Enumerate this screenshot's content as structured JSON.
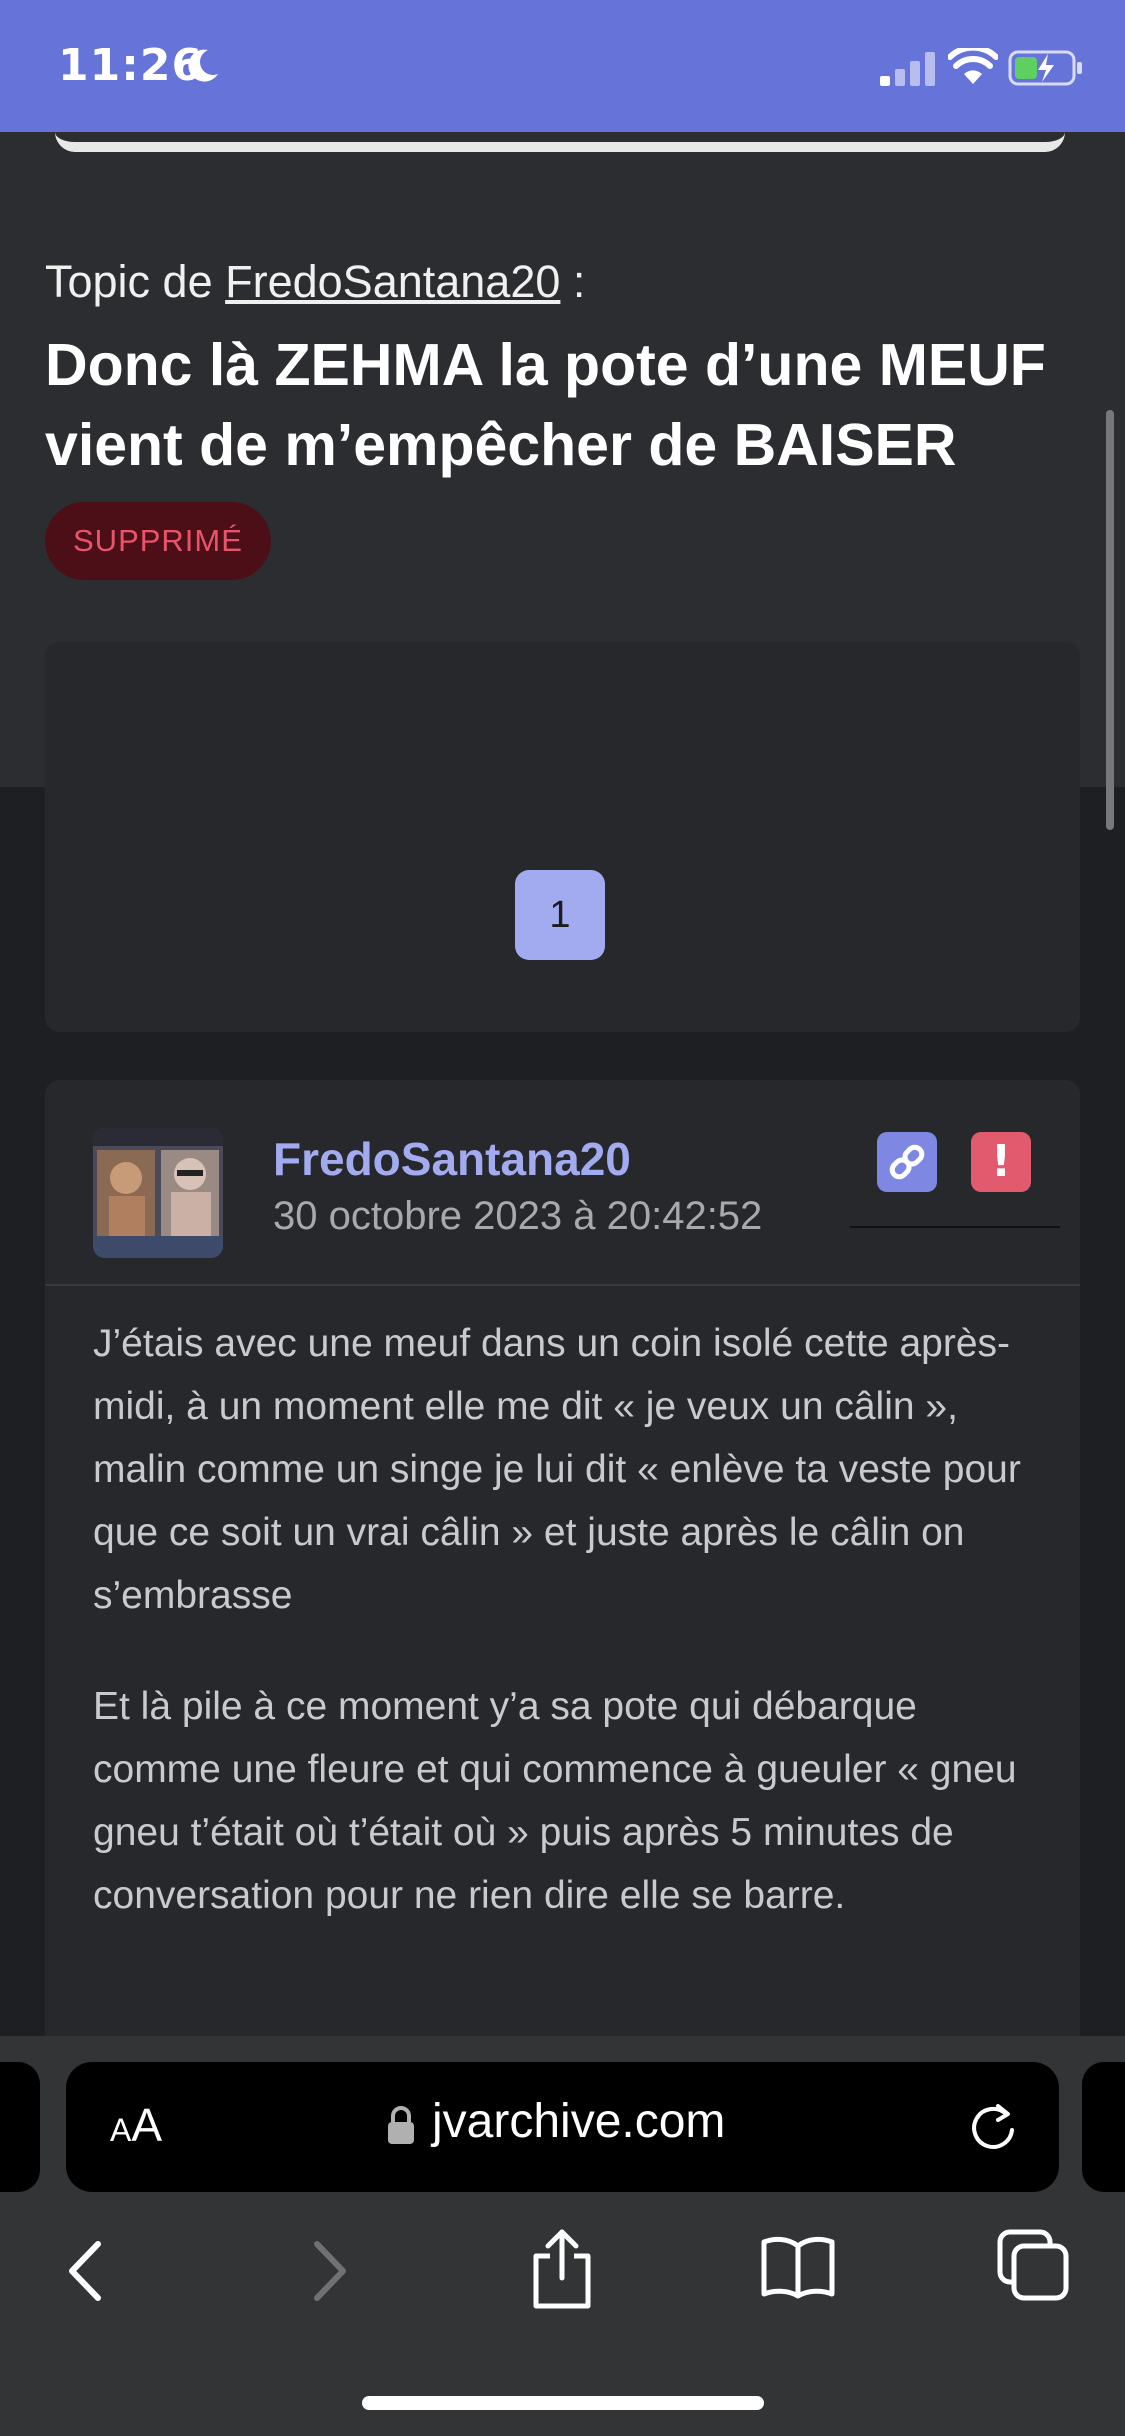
{
  "status_bar": {
    "time": "11:26",
    "icons": [
      "moon-icon",
      "signal-icon",
      "wifi-icon",
      "battery-charging-icon"
    ]
  },
  "topic": {
    "prefix": "Topic de",
    "author": "FredoSantana20",
    "suffix": " :",
    "title": "Donc là ZEHMA la pote d’une MEUF vient de m’empêcher de BAISER",
    "status_badge": "SUPPRIMÉ"
  },
  "pagination": {
    "current_page": "1"
  },
  "message": {
    "author": "FredoSantana20",
    "date": "30 octobre 2023 à 20:42:52",
    "paragraphs": [
      "J’étais avec une meuf dans un coin isolé cette après-midi, à un moment elle me dit « je veux un câlin », malin comme un singe je lui dit « enlève ta veste pour que ce soit un vrai câlin » et juste après le câlin on s’embrasse",
      "Et là pile à ce moment y’a sa pote qui débarque comme une fleure et qui commence à gueuler « gneu gneu t’était où t’était où » puis après 5 minutes de conversation pour ne rien dire elle se barre."
    ],
    "actions": [
      "link-icon",
      "report-icon"
    ]
  },
  "browser": {
    "text_size_label_small": "A",
    "text_size_label_large": "A",
    "url": "jvarchive.com",
    "toolbar": [
      "back-icon",
      "forward-icon",
      "share-icon",
      "bookmarks-icon",
      "tabs-icon"
    ]
  },
  "colors": {
    "status_bar": "#6673d9",
    "accent": "#a3abf0",
    "danger": "#e25a6e",
    "badge_bg": "#4c0f18"
  }
}
